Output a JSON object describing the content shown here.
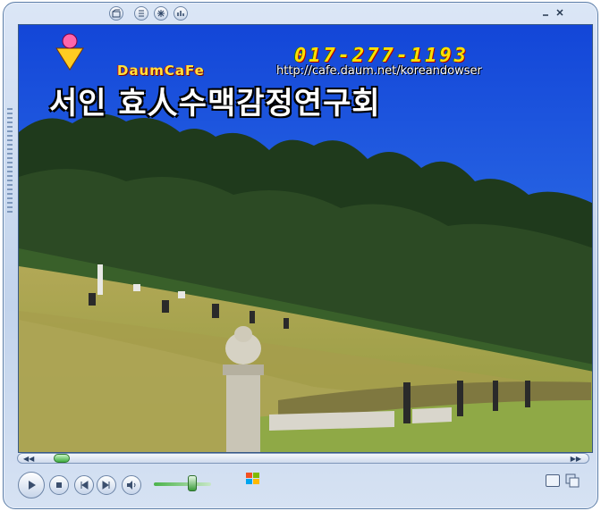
{
  "video_overlay": {
    "phone": "017-277-1193",
    "logo_text": "DaumCaFe",
    "url": "http://cafe.daum.net/koreandowser",
    "heading": "서인 효人수맥감정연구회"
  },
  "colors": {
    "window_frame": "#c2d3ec",
    "sky": "#1f5ee0",
    "grass": "#a7a24a",
    "seek_thumb": "#3fae3f"
  }
}
